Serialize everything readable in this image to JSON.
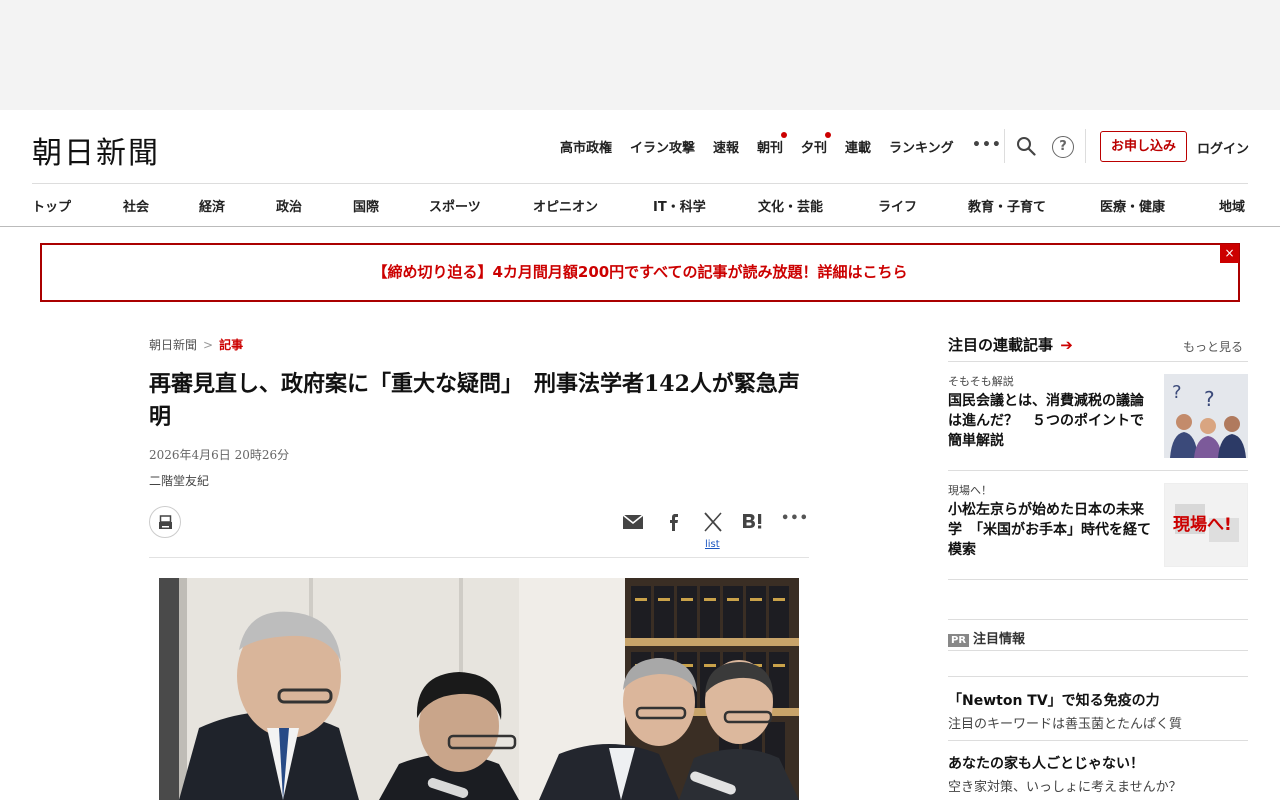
{
  "logo": "朝日新聞",
  "top_nav": [
    {
      "label": "高市政権",
      "dot": false
    },
    {
      "label": "イラン攻撃",
      "dot": false
    },
    {
      "label": "速報",
      "dot": false
    },
    {
      "label": "朝刊",
      "dot": true
    },
    {
      "label": "夕刊",
      "dot": true
    },
    {
      "label": "連載",
      "dot": false
    },
    {
      "label": "ランキング",
      "dot": false
    }
  ],
  "more_label": "•••",
  "help_label": "?",
  "subscribe_label": "お申し込み",
  "login_label": "ログイン",
  "categories": [
    "トップ",
    "社会",
    "経済",
    "政治",
    "国際",
    "スポーツ",
    "オピニオン",
    "IT・科学",
    "文化・芸能",
    "ライフ",
    "教育・子育て",
    "医療・健康",
    "地域"
  ],
  "promo": {
    "text": "【締め切り迫る】4カ月間月額200円ですべての記事が読み放題！詳細はこちら",
    "close": "×"
  },
  "article": {
    "breadcrumb": [
      "朝日新聞",
      "記事"
    ],
    "breadcrumb_sep": ">",
    "headline": "再審見直し、政府案に「重大な疑問」　刑事法学者142人が緊急声明",
    "date": "2026年4月6日 20時26分",
    "author": "二階堂友紀",
    "share_list_label": "list",
    "share_more": "•••"
  },
  "sidebar": {
    "heading": "注目の連載記事",
    "arrow": "➔",
    "more": "もっと見る",
    "items": [
      {
        "tag": "そもそも解説",
        "title": "国民会議とは、消費減税の議論は進んだ？　５つのポイントで簡単解説"
      },
      {
        "tag": "現場へ！",
        "title": "小松左京らが始めた日本の未来学　「米国がお手本」時代を経て模索"
      }
    ],
    "thumb2_text": "現場へ!",
    "pr_badge": "PR",
    "pr_heading": "注目情報",
    "pr_items": [
      {
        "title": "「Newton TV」で知る免疫の力",
        "sub": "注目のキーワードは善玉菌とたんぱく質"
      },
      {
        "title": "あなたの家も人ごとじゃない！",
        "sub": "空き家対策、いっしょに考えませんか？"
      }
    ]
  },
  "colors": {
    "accent": "#cc0000",
    "border": "#dddddd"
  }
}
